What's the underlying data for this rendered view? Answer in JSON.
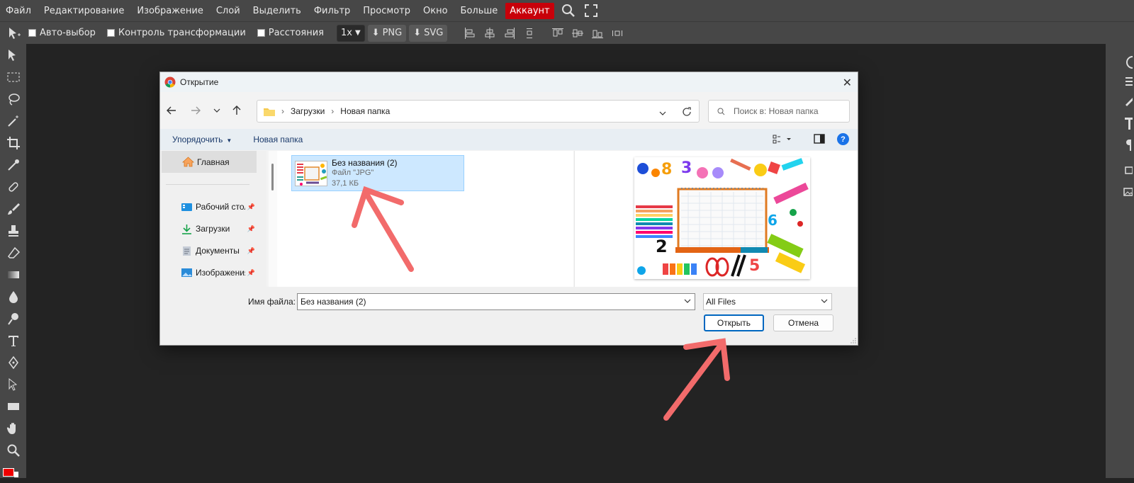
{
  "menu": {
    "items": [
      "Файл",
      "Редактирование",
      "Изображение",
      "Слой",
      "Выделить",
      "Фильтр",
      "Просмотр",
      "Окно",
      "Больше"
    ],
    "account": "Аккаунт"
  },
  "options": {
    "auto_select": "Авто-выбор",
    "transform_controls": "Контроль трансформации",
    "distances": "Расстояния",
    "scale": "1x",
    "png": "PNG",
    "svg": "SVG"
  },
  "dialog": {
    "title": "Открытие",
    "breadcrumb": [
      "Загрузки",
      "Новая папка"
    ],
    "search_placeholder": "Поиск в: Новая папка",
    "organize": "Упорядочить",
    "new_folder": "Новая папка",
    "nav": {
      "home": "Главная",
      "items": [
        {
          "label": "Рабочий стол",
          "icon": "desktop-icon"
        },
        {
          "label": "Загрузки",
          "icon": "downloads-icon"
        },
        {
          "label": "Документы",
          "icon": "documents-icon"
        },
        {
          "label": "Изображения",
          "icon": "pictures-icon"
        }
      ]
    },
    "file": {
      "name": "Без названия (2)",
      "type": "Файл \"JPG\"",
      "size": "37,1 КБ"
    },
    "filename_label": "Имя файла:",
    "filename_value": "Без названия (2)",
    "filetype_value": "All Files",
    "open_button": "Открыть",
    "cancel_button": "Отмена"
  },
  "colors": {
    "accent": "#0067c0",
    "account": "#c8000a",
    "annotation_arrow": "#f26b6b"
  }
}
